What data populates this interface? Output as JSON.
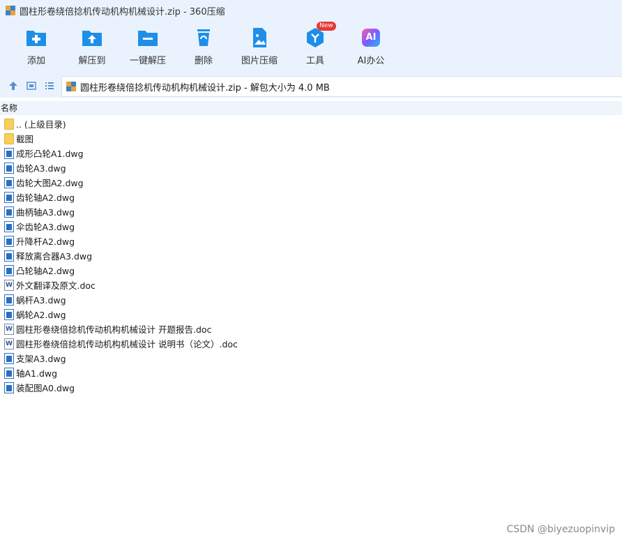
{
  "window": {
    "title": "圆柱形卷绕倍捻机传动机构机械设计.zip - 360压缩"
  },
  "toolbar": {
    "items": [
      {
        "label": "添加",
        "icon": "add-folder-icon"
      },
      {
        "label": "解压到",
        "icon": "extract-to-icon"
      },
      {
        "label": "一键解压",
        "icon": "one-click-extract-icon"
      },
      {
        "label": "删除",
        "icon": "delete-icon"
      },
      {
        "label": "图片压缩",
        "icon": "image-compress-icon"
      },
      {
        "label": "工具",
        "icon": "tools-icon",
        "badge": "New"
      },
      {
        "label": "AI办公",
        "icon": "ai-office-icon",
        "icon_text": "AI"
      }
    ]
  },
  "address": {
    "text": "圆柱形卷绕倍捻机传动机构机械设计.zip - 解包大小为 4.0 MB"
  },
  "list": {
    "header": "名称",
    "items": [
      {
        "name": ".. (上级目录)",
        "type": "folder"
      },
      {
        "name": "截图",
        "type": "folder"
      },
      {
        "name": "成形凸轮A1.dwg",
        "type": "dwg"
      },
      {
        "name": "齿轮A3.dwg",
        "type": "dwg"
      },
      {
        "name": "齿轮大图A2.dwg",
        "type": "dwg"
      },
      {
        "name": "齿轮轴A2.dwg",
        "type": "dwg"
      },
      {
        "name": "曲柄轴A3.dwg",
        "type": "dwg"
      },
      {
        "name": "伞齿轮A3.dwg",
        "type": "dwg"
      },
      {
        "name": "升降杆A2.dwg",
        "type": "dwg"
      },
      {
        "name": "释放离合器A3.dwg",
        "type": "dwg"
      },
      {
        "name": "凸轮轴A2.dwg",
        "type": "dwg"
      },
      {
        "name": "外文翻译及原文.doc",
        "type": "doc"
      },
      {
        "name": "蜗杆A3.dwg",
        "type": "dwg"
      },
      {
        "name": "蜗轮A2.dwg",
        "type": "dwg"
      },
      {
        "name": "圆柱形卷绕倍捻机传动机构机械设计 开题报告.doc",
        "type": "doc"
      },
      {
        "name": "圆柱形卷绕倍捻机传动机构机械设计 说明书（论文）.doc",
        "type": "doc"
      },
      {
        "name": "支架A3.dwg",
        "type": "dwg"
      },
      {
        "name": "轴A1.dwg",
        "type": "dwg"
      },
      {
        "name": "装配图A0.dwg",
        "type": "dwg"
      }
    ]
  },
  "watermark": "CSDN @biyezuopinvip",
  "colors": {
    "accent": "#1e8fe8",
    "chrome": "#eaf3fd",
    "badge": "#e53935",
    "folder": "#f7cf5b"
  }
}
